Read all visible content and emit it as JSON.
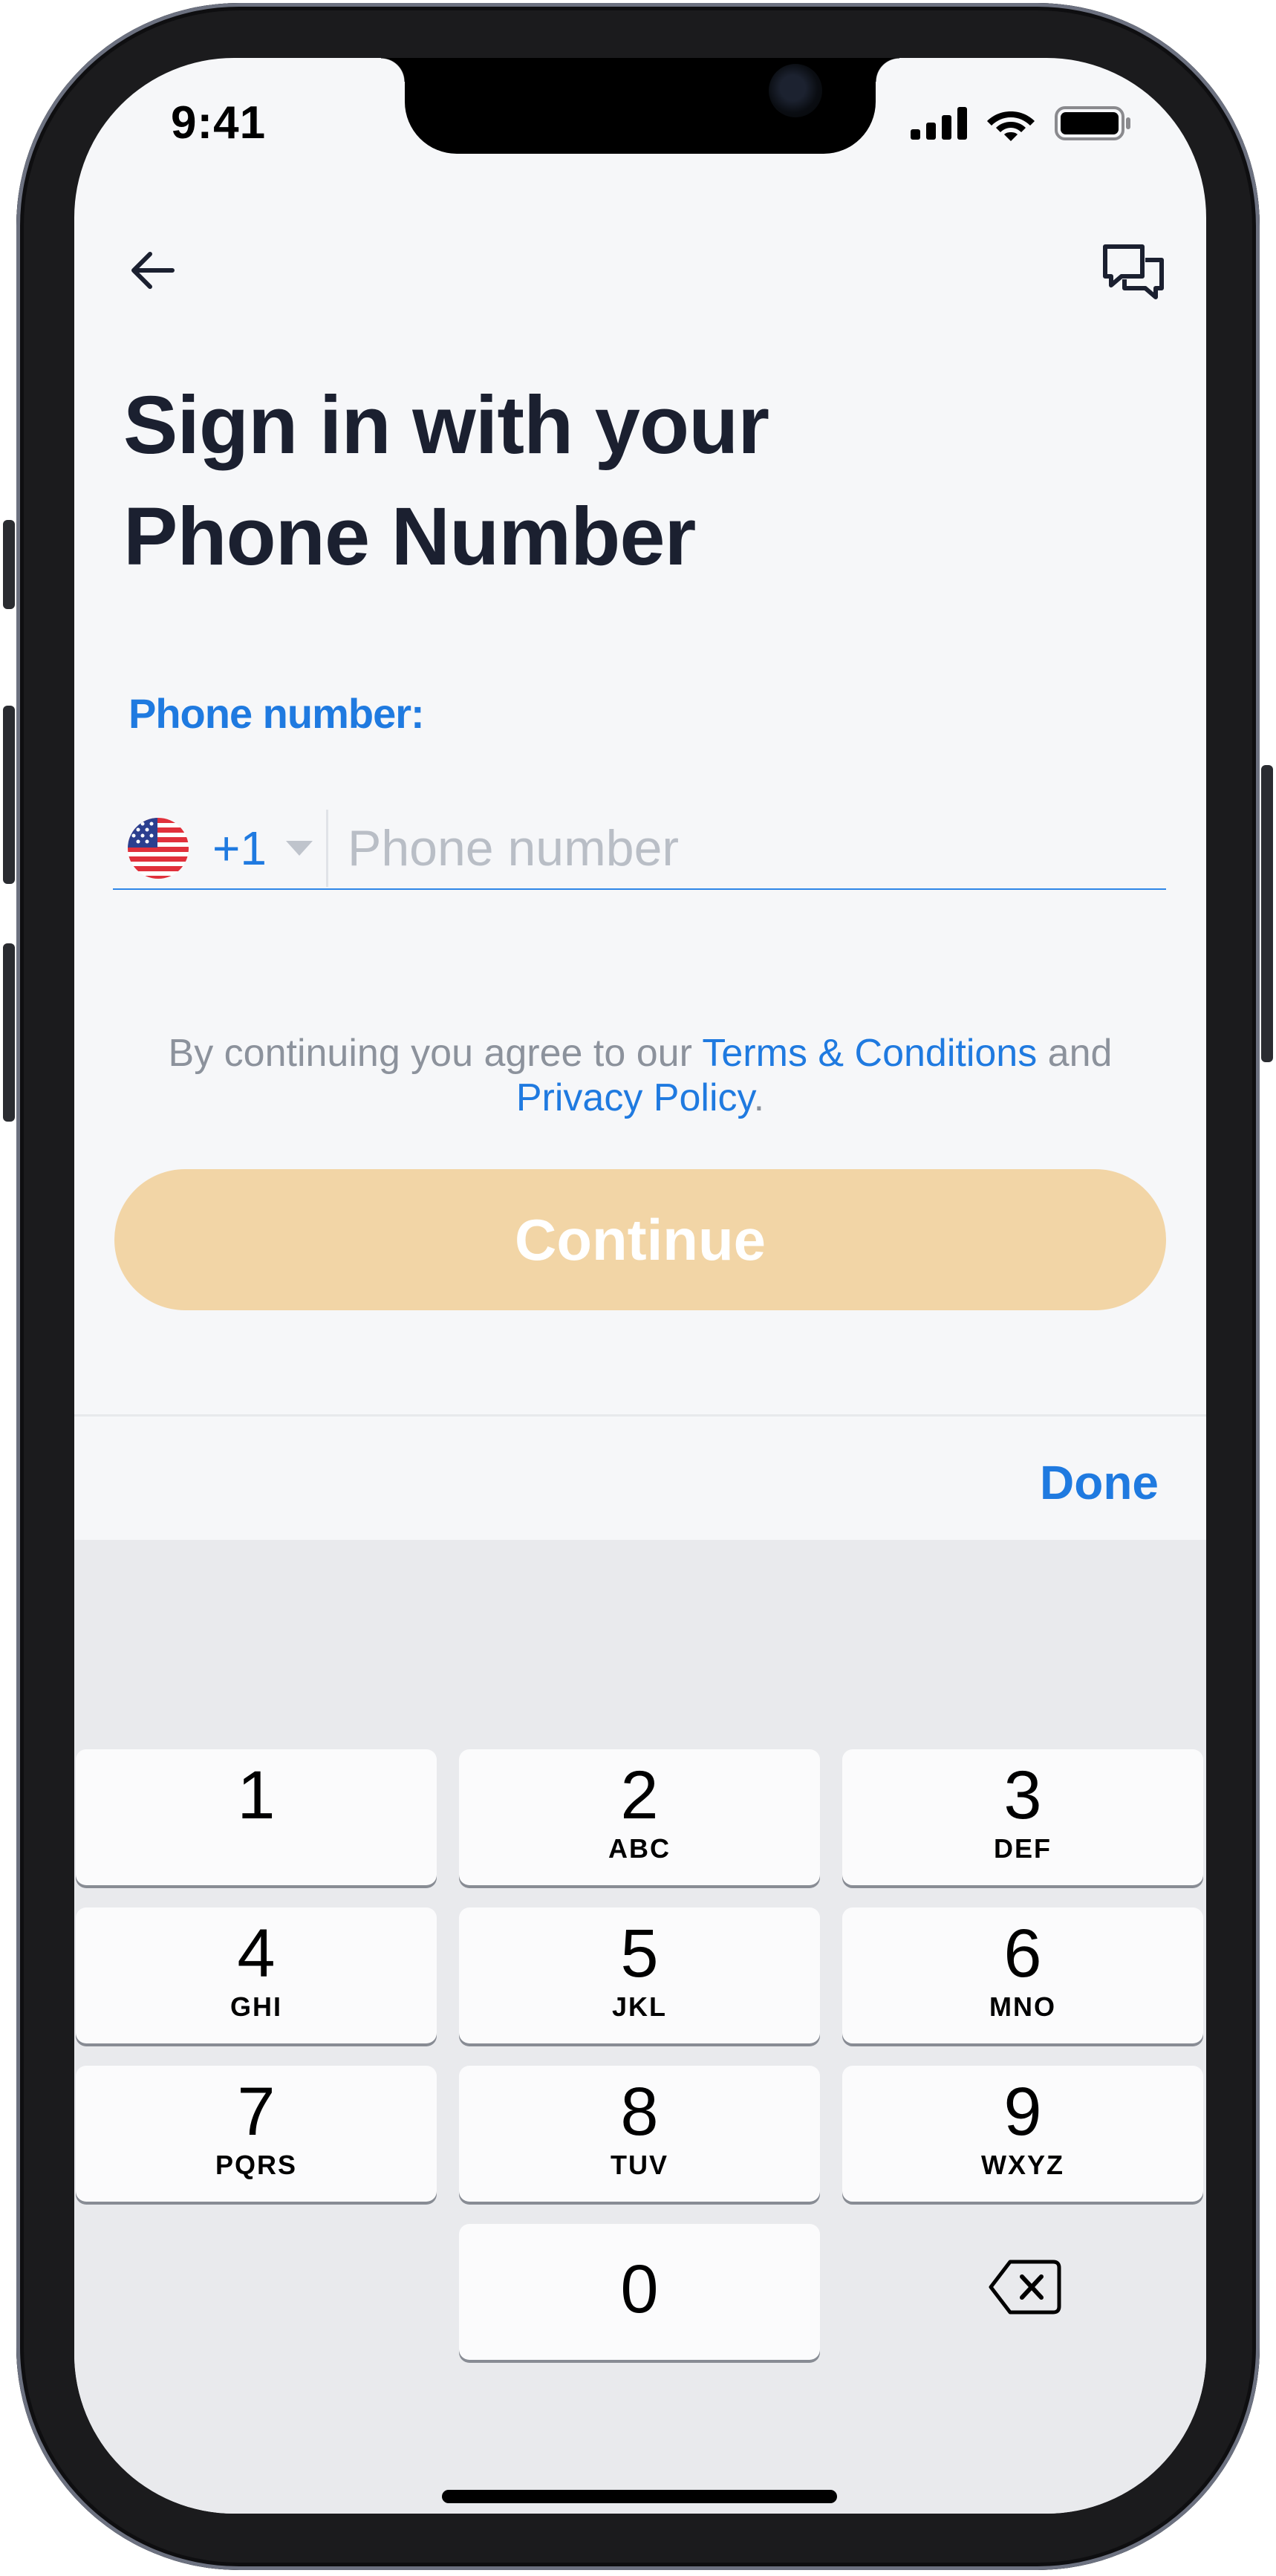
{
  "status_bar": {
    "time": "9:41"
  },
  "header": {
    "back_icon": "arrow-left-icon",
    "chat_icon": "chat-bubbles-icon"
  },
  "title": {
    "line1": "Sign in with your",
    "line2": "Phone Number"
  },
  "phone_field": {
    "label": "Phone number:",
    "country_flag": "us-flag-icon",
    "dial_code": "+1",
    "placeholder": "Phone number",
    "value": ""
  },
  "terms": {
    "prefix": "By continuing you agree to our ",
    "terms_link": "Terms & Conditions",
    "middle": " and",
    "privacy_link": "Privacy Policy",
    "suffix": "."
  },
  "continue_button": {
    "label": "Continue",
    "enabled": false
  },
  "keyboard_toolbar": {
    "done_label": "Done"
  },
  "keypad": {
    "keys": [
      {
        "num": "1",
        "letters": ""
      },
      {
        "num": "2",
        "letters": "ABC"
      },
      {
        "num": "3",
        "letters": "DEF"
      },
      {
        "num": "4",
        "letters": "GHI"
      },
      {
        "num": "5",
        "letters": "JKL"
      },
      {
        "num": "6",
        "letters": "MNO"
      },
      {
        "num": "7",
        "letters": "PQRS"
      },
      {
        "num": "8",
        "letters": "TUV"
      },
      {
        "num": "9",
        "letters": "WXYZ"
      },
      {
        "num": "0",
        "letters": ""
      }
    ],
    "delete_icon": "backspace-icon"
  },
  "colors": {
    "accent": "#1f7ae0",
    "title_text": "#1b2030",
    "continue_disabled": "#f2d5a6",
    "screen_bg": "#f6f7f9",
    "keyboard_bg": "#e9eaed"
  }
}
